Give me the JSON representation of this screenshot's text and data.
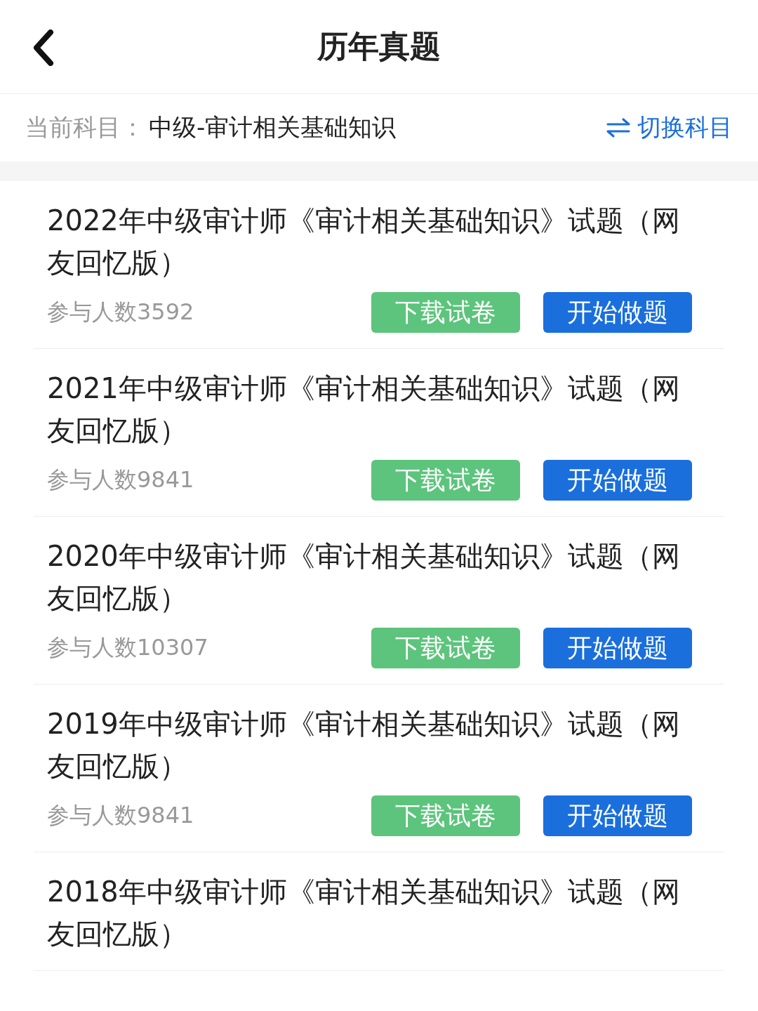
{
  "header": {
    "title": "历年真题"
  },
  "subject": {
    "label": "当前科目：",
    "value": "中级-审计相关基础知识",
    "switch_label": "切换科目"
  },
  "papers": [
    {
      "title": "2022年中级审计师《审计相关基础知识》试题（网友回忆版）",
      "participants": "参与人数3592",
      "download": "下载试卷",
      "start": "开始做题"
    },
    {
      "title": "2021年中级审计师《审计相关基础知识》试题（网友回忆版）",
      "participants": "参与人数9841",
      "download": "下载试卷",
      "start": "开始做题"
    },
    {
      "title": "2020年中级审计师《审计相关基础知识》试题（网友回忆版）",
      "participants": "参与人数10307",
      "download": "下载试卷",
      "start": "开始做题"
    },
    {
      "title": "2019年中级审计师《审计相关基础知识》试题（网友回忆版）",
      "participants": "参与人数9841",
      "download": "下载试卷",
      "start": "开始做题"
    },
    {
      "title": "2018年中级审计师《审计相关基础知识》试题（网友回忆版）"
    }
  ]
}
